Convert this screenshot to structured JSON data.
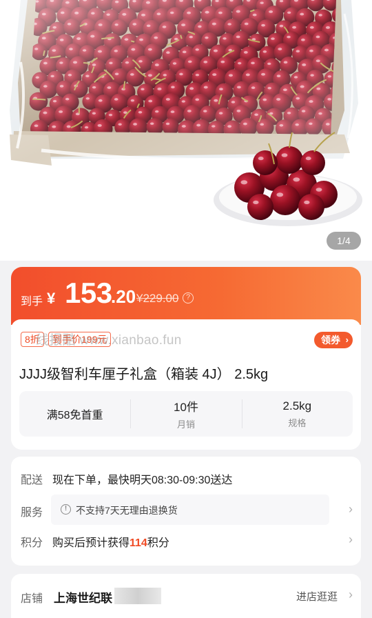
{
  "gallery": {
    "counter": "1/4"
  },
  "price": {
    "label": "到手",
    "currency": "¥",
    "integer": "153",
    "decimal": ".20",
    "original": "¥229.00",
    "help_icon": "?"
  },
  "tags": {
    "discount": "8折",
    "final_price": "到手价199元"
  },
  "watermark": "线报酷 www.xianbao.fun",
  "coupon": {
    "label": "领券",
    "chevron": "›"
  },
  "product": {
    "title": "JJJJ级智利车厘子礼盒（箱装 4J） 2.5kg"
  },
  "stats": {
    "shipping": "满58免首重",
    "sales_value": "10件",
    "sales_label": "月销",
    "spec_value": "2.5kg",
    "spec_label": "规格"
  },
  "delivery": {
    "label": "配送",
    "text": "现在下单，最快明天08:30-09:30送达"
  },
  "service": {
    "label": "服务",
    "alert_icon": "!",
    "text": "不支持7天无理由退换货",
    "chevron": "›"
  },
  "points": {
    "label": "积分",
    "prefix": "购买后预计获得",
    "value": "114",
    "suffix": "积分",
    "chevron": "›"
  },
  "store": {
    "label": "店铺",
    "name": "上海世纪联",
    "link": "进店逛逛",
    "chevron": "›"
  },
  "colors": {
    "accent": "#f24e2c",
    "highlight": "#f04b25",
    "cherry": "#8e0f1c"
  }
}
